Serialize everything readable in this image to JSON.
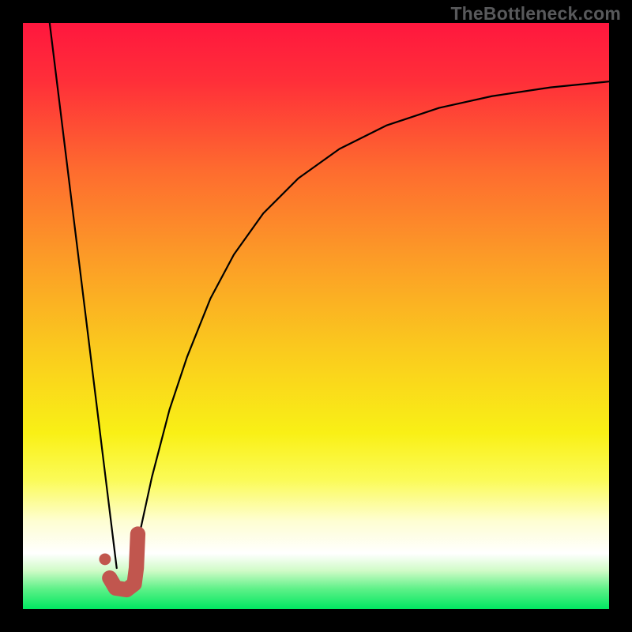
{
  "watermark": {
    "text": "TheBottleneck.com"
  },
  "chart_data": {
    "type": "line",
    "title": "",
    "xlabel": "",
    "ylabel": "",
    "xlim": [
      0,
      100
    ],
    "ylim": [
      0,
      100
    ],
    "background": {
      "type": "vertical_gradient",
      "stops": [
        {
          "pos": 0.0,
          "color": "#ff173e"
        },
        {
          "pos": 0.1,
          "color": "#ff2f39"
        },
        {
          "pos": 0.25,
          "color": "#fe6b2f"
        },
        {
          "pos": 0.4,
          "color": "#fc9b27"
        },
        {
          "pos": 0.55,
          "color": "#fac81e"
        },
        {
          "pos": 0.7,
          "color": "#f9f016"
        },
        {
          "pos": 0.78,
          "color": "#fbfb58"
        },
        {
          "pos": 0.85,
          "color": "#fefed2"
        },
        {
          "pos": 0.905,
          "color": "#ffffff"
        },
        {
          "pos": 0.935,
          "color": "#cffbc6"
        },
        {
          "pos": 0.965,
          "color": "#60f189"
        },
        {
          "pos": 1.0,
          "color": "#00e761"
        }
      ]
    },
    "series": [
      {
        "name": "left_branch",
        "stroke": "#000000",
        "stroke_width": 2.2,
        "points": [
          {
            "x": 4.5,
            "y": 100.5
          },
          {
            "x": 16.0,
            "y": 7.0
          }
        ]
      },
      {
        "name": "right_branch",
        "stroke": "#000000",
        "stroke_width": 2.2,
        "points": [
          {
            "x": 18.0,
            "y": 5.0
          },
          {
            "x": 19.5,
            "y": 11.0
          },
          {
            "x": 22.0,
            "y": 22.5
          },
          {
            "x": 25.0,
            "y": 34.0
          },
          {
            "x": 28.0,
            "y": 43.0
          },
          {
            "x": 32.0,
            "y": 53.0
          },
          {
            "x": 36.0,
            "y": 60.5
          },
          {
            "x": 41.0,
            "y": 67.5
          },
          {
            "x": 47.0,
            "y": 73.5
          },
          {
            "x": 54.0,
            "y": 78.5
          },
          {
            "x": 62.0,
            "y": 82.5
          },
          {
            "x": 71.0,
            "y": 85.5
          },
          {
            "x": 80.0,
            "y": 87.5
          },
          {
            "x": 90.0,
            "y": 89.0
          },
          {
            "x": 100.0,
            "y": 90.0
          }
        ]
      }
    ],
    "markers": [
      {
        "name": "dot_marker",
        "shape": "circle",
        "color": "#c1564e",
        "cx": 14.0,
        "cy": 8.5,
        "r": 1.0
      },
      {
        "name": "j_marker",
        "shape": "custom_path",
        "color": "#c1564e",
        "stroke_width": 2.6,
        "points": [
          {
            "x": 19.6,
            "y": 12.8
          },
          {
            "x": 19.35,
            "y": 7.0
          },
          {
            "x": 19.0,
            "y": 4.3
          },
          {
            "x": 17.7,
            "y": 3.3
          },
          {
            "x": 15.8,
            "y": 3.6
          },
          {
            "x": 14.8,
            "y": 5.3
          }
        ]
      }
    ]
  }
}
